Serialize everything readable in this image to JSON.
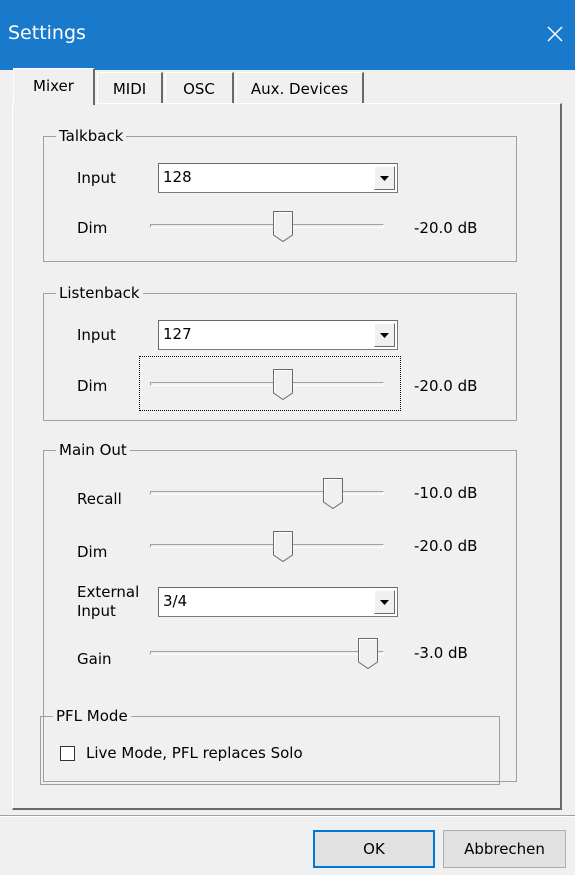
{
  "window": {
    "title": "Settings"
  },
  "tabs": [
    {
      "label": "Mixer",
      "active": true
    },
    {
      "label": "MIDI",
      "active": false
    },
    {
      "label": "OSC",
      "active": false
    },
    {
      "label": "Aux. Devices",
      "active": false
    }
  ],
  "talkback": {
    "title": "Talkback",
    "input_label": "Input",
    "input_value": "128",
    "dim_label": "Dim",
    "dim_value": "-20.0 dB",
    "dim_level": 0.57
  },
  "listenback": {
    "title": "Listenback",
    "input_label": "Input",
    "input_value": "127",
    "dim_label": "Dim",
    "dim_value": "-20.0 dB",
    "dim_level": 0.57
  },
  "main_out": {
    "title": "Main Out",
    "recall_label": "Recall",
    "recall_value": "-10.0 dB",
    "recall_level": 0.78,
    "dim_label": "Dim",
    "dim_value": "-20.0 dB",
    "dim_level": 0.57,
    "external_input_label_line1": "External",
    "external_input_label_line2": "Input",
    "external_input_value": "3/4",
    "gain_label": "Gain",
    "gain_value": "-3.0 dB",
    "gain_level": 0.93
  },
  "pfl_mode": {
    "title": "PFL Mode",
    "checkbox_label": "Live Mode,  PFL replaces Solo",
    "checked": false
  },
  "buttons": {
    "ok": "OK",
    "cancel": "Abbrechen"
  }
}
